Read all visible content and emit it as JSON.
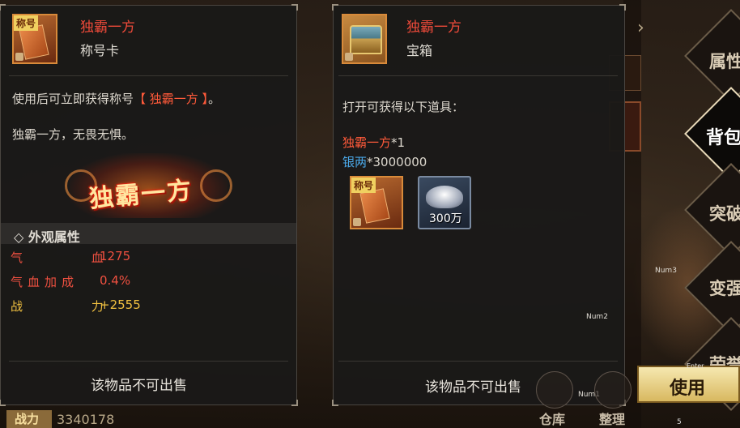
{
  "left_panel": {
    "item_tag": "称号",
    "item_name": "独霸一方",
    "item_type": "称号卡",
    "desc_prefix": "使用后可立即获得称号",
    "desc_highlight": "【 独霸一方 】",
    "desc_suffix": "。",
    "flavor": "独霸一方，无畏无惧。",
    "banner_text": "独霸一方",
    "attr_header": "◇ 外观属性",
    "attributes": [
      {
        "name": "气 血",
        "value": "1275"
      },
      {
        "name": "气血加成",
        "value": "0.4%"
      },
      {
        "name": "战 力",
        "value": "+2555"
      }
    ],
    "footer": "该物品不可出售"
  },
  "right_panel": {
    "item_name": "独霸一方",
    "item_type": "宝箱",
    "open_text": "打开可获得以下道具：",
    "reward_1_name": "独霸一方",
    "reward_1_qty": "*1",
    "reward_2_name": "银两",
    "reward_2_qty": "*3000000",
    "reward_icon_tag": "称号",
    "silver_label": "300万",
    "footer": "该物品不可出售"
  },
  "side_nav": {
    "items": [
      "属性",
      "背包",
      "突破",
      "变强",
      "荣誉"
    ],
    "active": "背包"
  },
  "actions": {
    "use": "使用",
    "enter_hint": "Enter",
    "warehouse": "仓库",
    "sort": "整理"
  },
  "hints": {
    "num1": "Num1",
    "num2": "Num2",
    "num3": "Num3"
  },
  "power": {
    "label": "战力",
    "value": "3340178"
  },
  "footnote": "5"
}
